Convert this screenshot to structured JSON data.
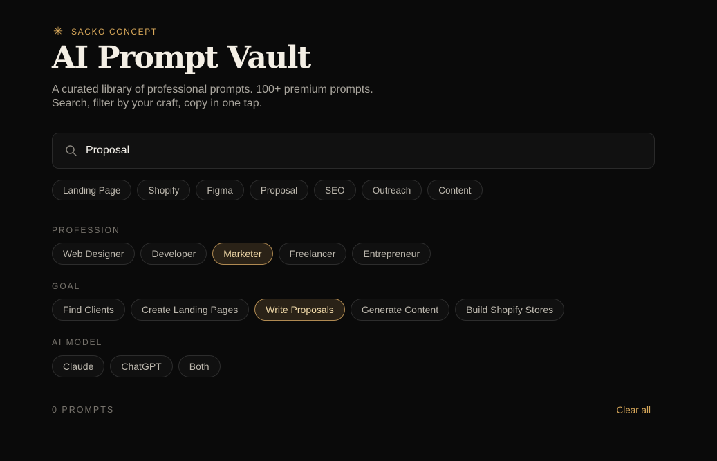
{
  "brand": {
    "icon": "asterisk-icon",
    "name": "SACKO CONCEPT",
    "accent": "#d8a85a"
  },
  "header": {
    "title": "AI Prompt Vault",
    "subtitle_line1": "A curated library of professional prompts. 100+ premium prompts.",
    "subtitle_line2": "Search, filter by your craft, copy in one tap."
  },
  "search": {
    "icon": "search-icon",
    "value": "Proposal",
    "placeholder": ""
  },
  "quick_tags": [
    "Landing Page",
    "Shopify",
    "Figma",
    "Proposal",
    "SEO",
    "Outreach",
    "Content"
  ],
  "profession": {
    "label": "PROFESSION",
    "options": [
      "Web Designer",
      "Developer",
      "Marketer",
      "Freelancer",
      "Entrepreneur"
    ],
    "selected": "Marketer"
  },
  "goal": {
    "label": "GOAL",
    "options": [
      "Find Clients",
      "Create Landing Pages",
      "Write Proposals",
      "Generate Content",
      "Build Shopify Stores"
    ],
    "selected": "Write Proposals"
  },
  "ai_model": {
    "label": "AI MODEL",
    "options": [
      "Claude",
      "ChatGPT",
      "Both"
    ],
    "selected": ""
  },
  "results": {
    "count_label": "0 PROMPTS",
    "clear_label": "Clear all"
  },
  "colors": {
    "background": "#0a0a0a",
    "active_chip_border": "#b08a52",
    "active_chip_bg": "#2a2217"
  }
}
